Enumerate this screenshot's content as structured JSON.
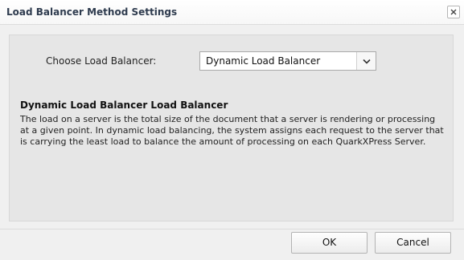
{
  "dialog": {
    "title": "Load Balancer Method Settings",
    "close_icon": "close-x-icon"
  },
  "form": {
    "choose_label": "Choose Load Balancer:",
    "selected_balancer": "Dynamic Load Balancer",
    "dropdown_icon": "chevron-down-icon"
  },
  "description": {
    "heading": "Dynamic Load Balancer Load Balancer",
    "body": "The load on a server is the total size of the document that a server is rendering or processing at a given point. In dynamic load balancing, the system assigns each request to the server that is carrying the least load to balance the amount of processing on each QuarkXPress Server."
  },
  "buttons": {
    "ok": "OK",
    "cancel": "Cancel"
  }
}
